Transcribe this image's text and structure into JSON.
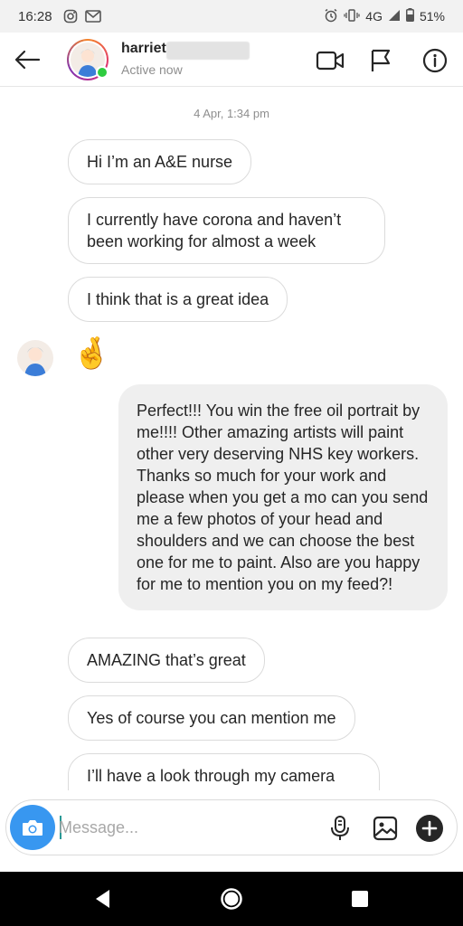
{
  "status_bar": {
    "time": "16:28",
    "network": "4G",
    "battery": "51%"
  },
  "header": {
    "username": "harriet",
    "status": "Active now"
  },
  "chat": {
    "timestamp": "4 Apr, 1:34 pm",
    "messages": [
      {
        "from": "them",
        "text": "Hi I’m an A&E nurse"
      },
      {
        "from": "them",
        "text": "I currently have corona and haven’t been working for almost a week"
      },
      {
        "from": "them",
        "text": "I think that is a great idea"
      },
      {
        "from": "them",
        "text": "🤞"
      },
      {
        "from": "me",
        "text": "Perfect!!! You win the free oil portrait by me!!!! Other amazing artists will paint other very deserving NHS key workers. Thanks so much for your work and please when you get a mo can you send me a few photos of your head and shoulders and we can choose the best one for me to paint. Also are you happy for me to mention you on my feed?!"
      },
      {
        "from": "them",
        "text": "AMAZING that’s great"
      },
      {
        "from": "them",
        "text": "Yes of course you can mention me"
      },
      {
        "from": "them",
        "text": "I’ll have a look through my camera roll"
      }
    ]
  },
  "composer": {
    "placeholder": "Message..."
  },
  "icons": {
    "back": "arrow-left-icon",
    "video": "video-call-icon",
    "flag": "flag-icon",
    "info": "info-icon",
    "camera": "camera-icon",
    "mic": "microphone-icon",
    "gallery": "image-icon",
    "add": "plus-circle-icon"
  },
  "colors": {
    "accent": "#3897f0",
    "online": "#2ecc40"
  }
}
